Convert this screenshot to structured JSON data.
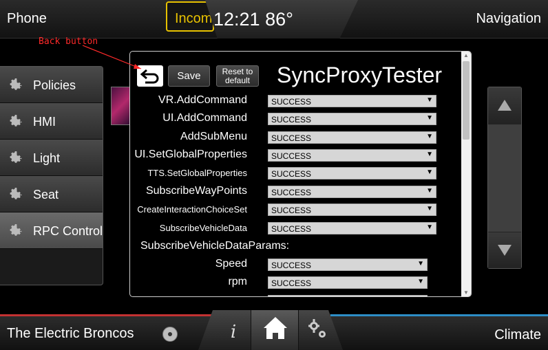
{
  "topbar": {
    "left_label": "Phone",
    "incoming_label": "Incoming",
    "clock": "12:21 86°",
    "right_label": "Navigation"
  },
  "sidemenu": {
    "items": [
      {
        "label": "Policies",
        "icon": "gear-icon"
      },
      {
        "label": "HMI",
        "icon": "gear-icon"
      },
      {
        "label": "Light",
        "icon": "gear-icon"
      },
      {
        "label": "Seat",
        "icon": "gear-icon"
      },
      {
        "label": "RPC Control",
        "icon": "gear-icon"
      }
    ]
  },
  "annotation": {
    "text": "Back button",
    "color": "#ff2a2a"
  },
  "dialog": {
    "title": "SyncProxyTester",
    "save_label": "Save",
    "reset_label": "Reset to\ndefault",
    "rows": [
      {
        "label": "VR.AddCommand",
        "value": "SUCCESS"
      },
      {
        "label": "UI.AddCommand",
        "value": "SUCCESS"
      },
      {
        "label": "AddSubMenu",
        "value": "SUCCESS"
      },
      {
        "label": "UI.SetGlobalProperties",
        "value": "SUCCESS"
      },
      {
        "label": "TTS.SetGlobalProperties",
        "value": "SUCCESS"
      },
      {
        "label": "SubscribeWayPoints",
        "value": "SUCCESS"
      },
      {
        "label": "CreateInteractionChoiceSet",
        "value": "SUCCESS"
      },
      {
        "label": "SubscribeVehicleData",
        "value": "SUCCESS"
      }
    ],
    "section_label": "SubscribeVehicleDataParams:",
    "params": [
      {
        "label": "Speed",
        "value": "SUCCESS"
      },
      {
        "label": "rpm",
        "value": "SUCCESS"
      }
    ]
  },
  "bottombar": {
    "left_label": "The Electric Broncos",
    "info_glyph": "i",
    "right_label": "Climate"
  }
}
